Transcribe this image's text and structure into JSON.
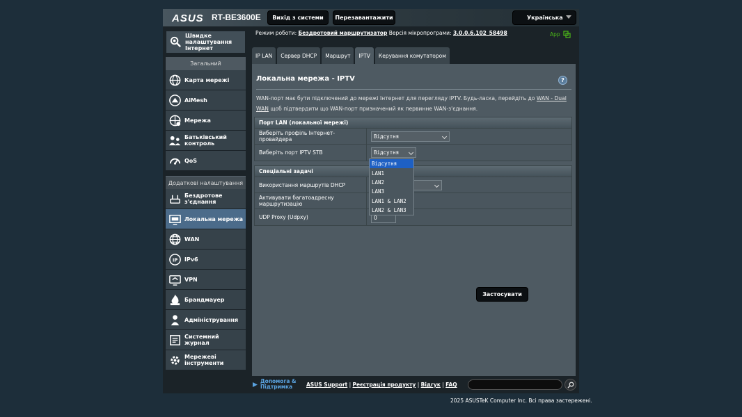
{
  "header": {
    "logo": "ASUS",
    "model": "RT-BE3600E",
    "logout_label": "Вихід з системи",
    "reboot_label": "Перезавантажити",
    "language": "Українська"
  },
  "sidebar": {
    "quick_setup": "Швидке налаштування Інтернет",
    "general_head": "Загальний",
    "general_items": [
      {
        "label": "Карта мережі",
        "icon": "network-map-icon"
      },
      {
        "label": "AiMesh",
        "icon": "aimesh-icon"
      },
      {
        "label": "Мережа",
        "icon": "network-icon"
      },
      {
        "label": "Батьківський контроль",
        "icon": "parental-control-icon"
      },
      {
        "label": "QoS",
        "icon": "qos-icon"
      }
    ],
    "advanced_head": "Додаткові налаштування",
    "advanced_items": [
      {
        "label": "Бездротове з'єднання",
        "icon": "wireless-icon"
      },
      {
        "label": "Локальна мережа",
        "icon": "lan-icon",
        "active": true
      },
      {
        "label": "WAN",
        "icon": "wan-icon"
      },
      {
        "label": "IPv6",
        "icon": "ipv6-icon"
      },
      {
        "label": "VPN",
        "icon": "vpn-icon"
      },
      {
        "label": "Брандмауер",
        "icon": "firewall-icon"
      },
      {
        "label": "Адміністрування",
        "icon": "administration-icon"
      },
      {
        "label": "Системний журнал",
        "icon": "system-log-icon"
      },
      {
        "label": "Мережеві інструменти",
        "icon": "network-tools-icon"
      }
    ]
  },
  "status": {
    "mode_label": "Режим роботи:",
    "mode_value": "Бездротовий маршрутизатор",
    "fw_label": "Версія мікропрограми:",
    "fw_value": "3.0.0.6.102_58498",
    "app": "App"
  },
  "tabs": [
    "IP LAN",
    "Сервер DHCP",
    "Маршрут",
    "IPTV",
    "Керування комутатором"
  ],
  "panel": {
    "title": "Локальна мережа - IPTV",
    "help": "?",
    "desc_part1": "WAN-порт має бути підключений до мережі Інтернет для перегляду IPTV. Будь-ласка, перейдіть до ",
    "desc_link": "WAN - Dual WAN",
    "desc_part2": " щоб підтвердити що WAN-порт призначений як первинне WAN-з'єднання."
  },
  "lan_port_table": {
    "header": "Порт LAN (локальної мережі)",
    "isp_profile_label": "Виберіть профіль Інтернет-провайдера",
    "isp_profile_value": "Відсутня",
    "stb_port_label": "Виберіть порт IPTV STB",
    "stb_port_value": "Відсутня"
  },
  "special_table": {
    "header": "Спеціальні задачі",
    "dhcp_routes_label": "Використання маршрутів DHCP",
    "multicast_label": "Активувати багатоадресну маршрутизацію",
    "udpxy_label": "UDP Proxy (Udpxy)",
    "udpxy_value": "0"
  },
  "stb_dropdown_options": [
    "Відсутня",
    "LAN1",
    "LAN2",
    "LAN3",
    "LAN1 & LAN2",
    "LAN2 & LAN3"
  ],
  "apply_label": "Застосувати",
  "footer": {
    "help_support": "Допомога & Підтримка",
    "asus_support": "ASUS Support",
    "product_reg": "Реєстрація продукту",
    "feedback": "Відгук",
    "faq": "FAQ",
    "sep": " | ",
    "copyright": "2025 ASUSTeK Computer Inc. Всі права застережені."
  },
  "colors": {
    "accent_blue": "#1e60c4",
    "active_sidebar": "#4b6b8a",
    "app_green": "#4cbb17"
  }
}
